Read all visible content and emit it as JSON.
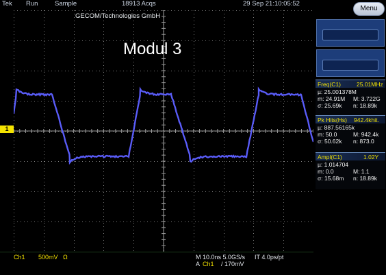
{
  "topbar": {
    "brand": "Tek",
    "run_state": "Run",
    "acq_mode": "Sample",
    "acqs": "18913 Acqs",
    "datetime": "29 Sep 21:10:05:52"
  },
  "menu_label": "Menu",
  "plot": {
    "company": "GECOM/Technologies GmbH",
    "title": "Modul 3"
  },
  "channel_marker": "1",
  "measurements": [
    {
      "header": "Freq(C1)",
      "header_value": "25.01MHz",
      "mu": "µ: 25.001378M",
      "m_label": "m: 24.91M",
      "M_label": "M: 3.722G",
      "sigma": "σ: 25.69k",
      "n": "n: 18.89k"
    },
    {
      "header": "Pk Hits(Hs)",
      "header_value": "942.4khit.",
      "mu": "µ: 887.56165k",
      "m_label": "m: 50.0",
      "M_label": "M: 942.4k",
      "sigma": "σ: 50.62k",
      "n": "n: 873.0"
    },
    {
      "header": "Ampl(C1)",
      "header_value": "1.02Y",
      "mu": "µ: 1.014704",
      "m_label": "m: 0.0",
      "M_label": "M: 1.1",
      "sigma": "σ: 15.68m",
      "n": "n: 18.89k"
    }
  ],
  "bottombar": {
    "channel": "Ch1",
    "scale": "500mV",
    "coupling": "Ω",
    "timebase": "M 10.0ns 5.0GS/s",
    "point_rate": "IT 4.0ps/pt",
    "trigger_src_prefix": "A",
    "trigger_src": "Ch1",
    "trigger_level": "/ 170mV"
  },
  "colors": {
    "trace": "#6a3df0",
    "trace_edge": "#3f8cff",
    "grid": "#7e7e7e",
    "channel": "#f4e300"
  }
}
